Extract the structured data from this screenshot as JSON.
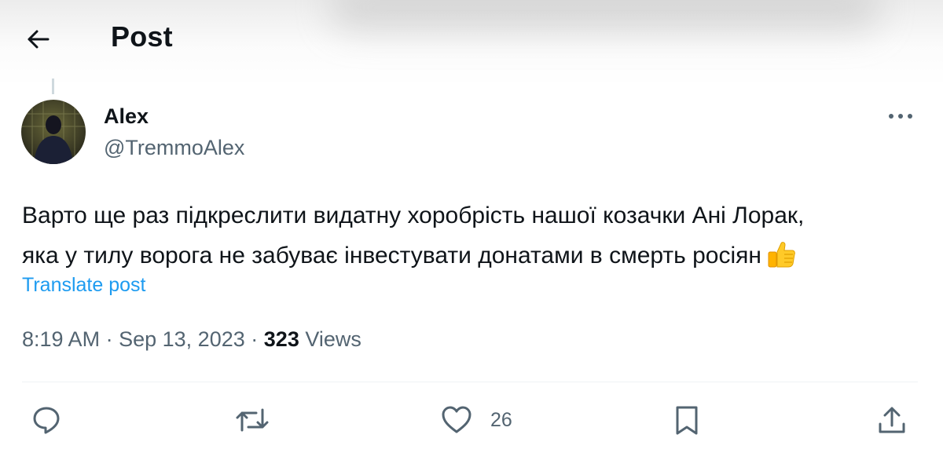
{
  "header": {
    "title": "Post",
    "back_icon": "arrow-left-icon"
  },
  "author": {
    "display_name": "Alex",
    "handle": "@TremmoAlex",
    "more_icon": "more-horizontal-icon"
  },
  "post": {
    "line1": "Варто ще раз підкреслити видатну хоробрість нашої козачки Ані Лорак,",
    "line2": "яка у тилу ворога не забуває інвестувати донатами в смерть росіян",
    "emoji": "thumbs-up-emoji",
    "translate_label": "Translate post"
  },
  "meta": {
    "time": "8:19 AM",
    "separator": "·",
    "date": "Sep 13, 2023",
    "views_count": "323",
    "views_label": "Views"
  },
  "actions": {
    "reply_icon": "reply-icon",
    "repost_icon": "repost-icon",
    "like_icon": "heart-icon",
    "like_count": "26",
    "bookmark_icon": "bookmark-icon",
    "share_icon": "share-icon"
  },
  "colors": {
    "text": "#0f1419",
    "secondary": "#536471",
    "link": "#1d9bf0",
    "divider": "#eff3f4"
  }
}
